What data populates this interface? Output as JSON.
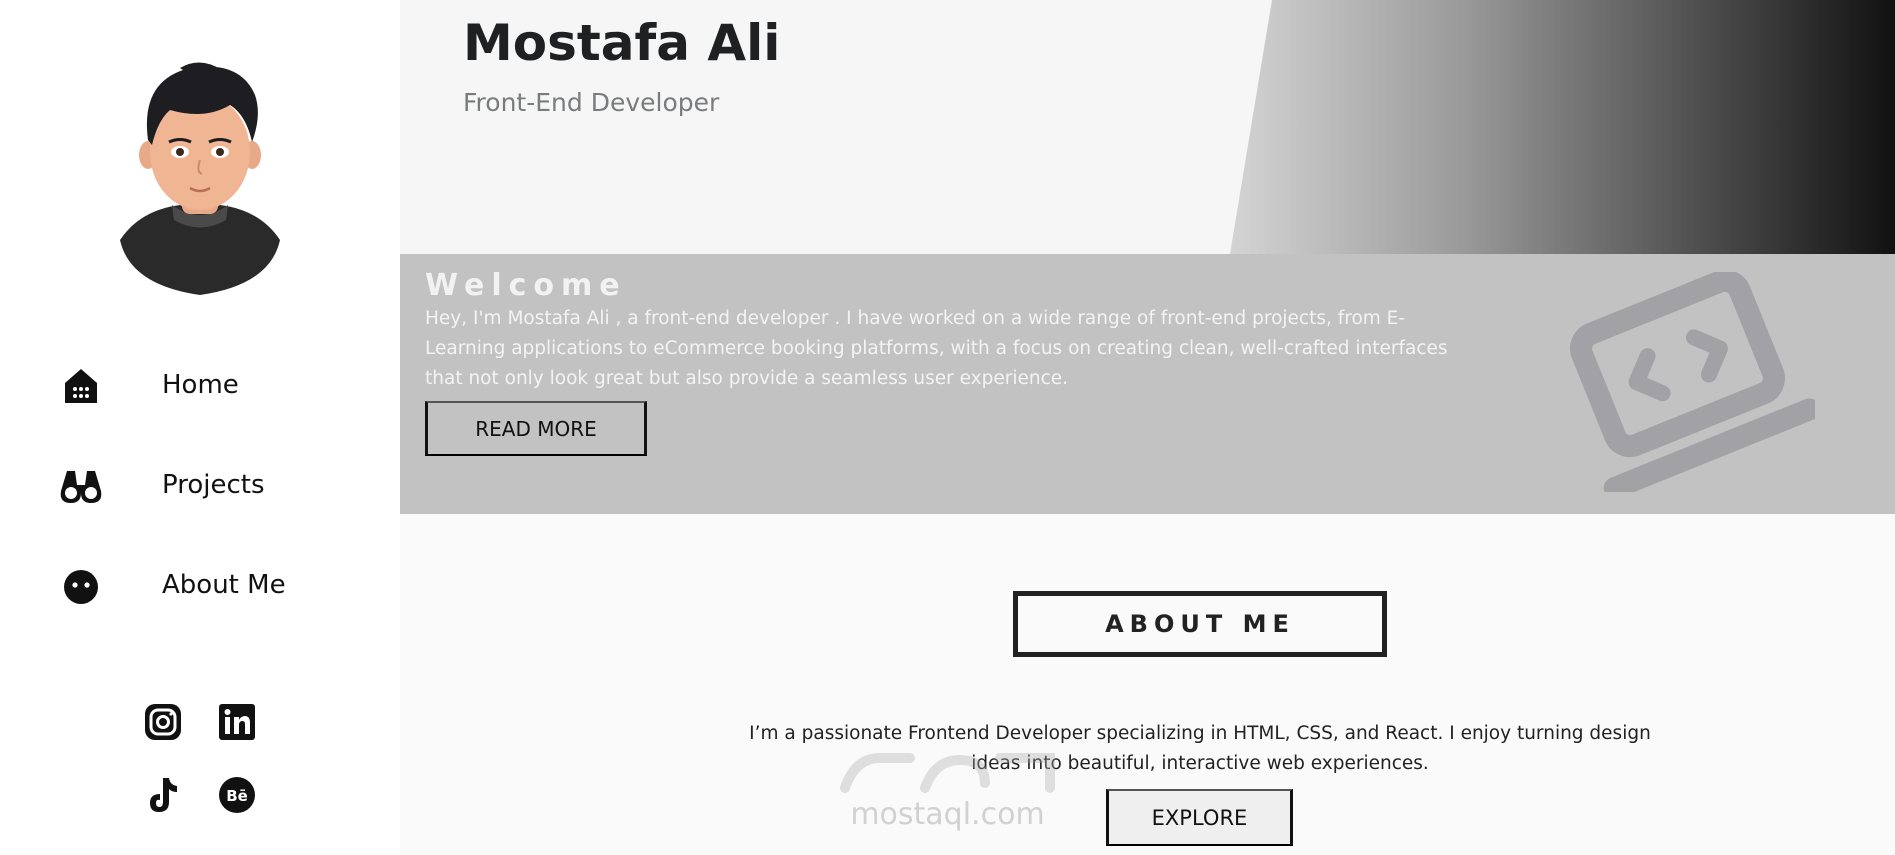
{
  "profile": {
    "name": "Mostafa Ali",
    "role": "Front-End Developer"
  },
  "sidebar": {
    "items": [
      {
        "label": "Home",
        "icon": "home-icon"
      },
      {
        "label": "Projects",
        "icon": "binoculars-icon"
      },
      {
        "label": "About Me",
        "icon": "face-icon"
      }
    ],
    "social": [
      {
        "icon": "instagram-icon"
      },
      {
        "icon": "linkedin-icon"
      },
      {
        "icon": "tiktok-icon"
      },
      {
        "icon": "behance-icon"
      }
    ]
  },
  "welcome": {
    "title": "Welcome",
    "text": "Hey, I'm Mostafa Ali , a front-end developer . I have worked on a wide range of front-end projects, from E-Learning applications to eCommerce booking platforms, with a focus on creating clean, well-crafted interfaces that not only look great but also provide a seamless user experience.",
    "button": "READ MORE",
    "icon": "laptop-code-icon"
  },
  "about": {
    "title": "ABOUT ME",
    "text": "I’m a passionate Frontend Developer specializing in HTML, CSS, and React. I enjoy turning design ideas into beautiful, interactive web experiences.",
    "button": "EXPLORE"
  },
  "watermark": {
    "text": "mostaql.com"
  },
  "colors": {
    "sidebar_bg": "#ffffff",
    "welcome_bg": "#c2c2c2",
    "text_dark": "#1e1f22",
    "role_gray": "#7a7b7d"
  }
}
